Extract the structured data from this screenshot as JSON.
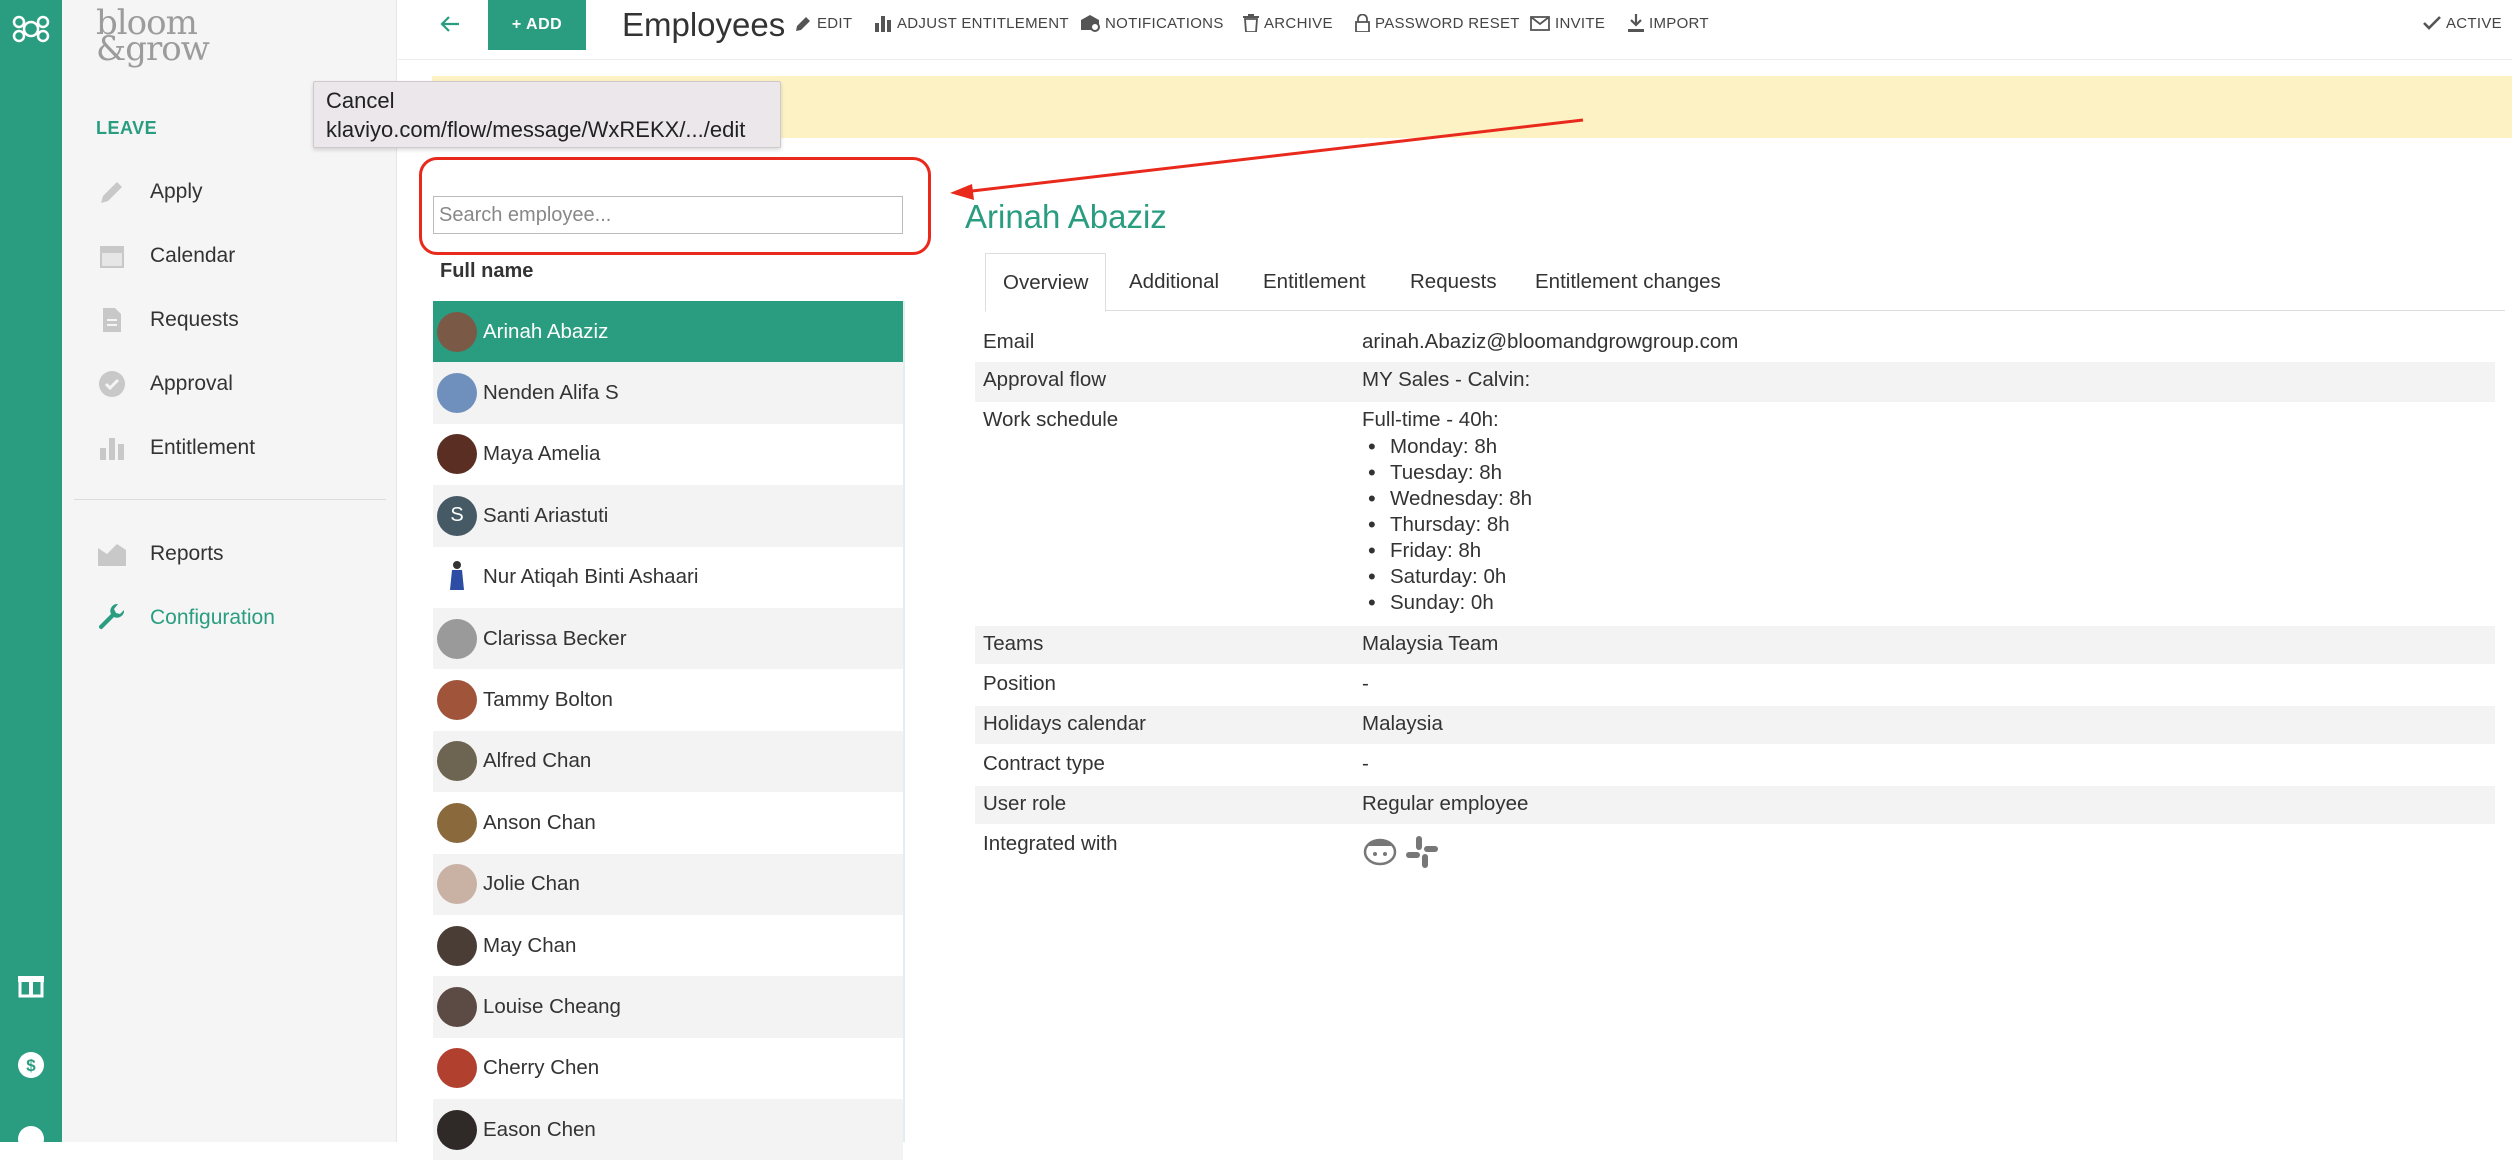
{
  "tooltip": {
    "line1": "Cancel",
    "line2": "klaviyo.com/flow/message/WxREKX/.../edit"
  },
  "sidebar": {
    "logo_line1": "bloom",
    "logo_line2": "&grow",
    "section_title": "LEAVE",
    "items": [
      {
        "label": "Apply",
        "icon": "pencil-icon"
      },
      {
        "label": "Calendar",
        "icon": "calendar-icon"
      },
      {
        "label": "Requests",
        "icon": "document-icon"
      },
      {
        "label": "Approval",
        "icon": "check-circle-icon"
      },
      {
        "label": "Entitlement",
        "icon": "bar-chart-icon"
      }
    ],
    "items2": [
      {
        "label": "Reports",
        "icon": "reports-icon"
      },
      {
        "label": "Configuration",
        "icon": "wrench-icon"
      }
    ]
  },
  "toolbar": {
    "add_label": "+ ADD",
    "title": "Employees",
    "edit": "EDIT",
    "adjust": "ADJUST ENTITLEMENT",
    "notifications": "NOTIFICATIONS",
    "archive": "ARCHIVE",
    "password_reset": "PASSWORD RESET",
    "invite": "INVITE",
    "import": "IMPORT",
    "active": "ACTIVE"
  },
  "search": {
    "placeholder": "Search employee..."
  },
  "list": {
    "header": "Full name",
    "employees": [
      "Arinah Abaziz",
      "Nenden Alifa S",
      "Maya Amelia",
      "Santi Ariastuti",
      "Nur Atiqah Binti Ashaari",
      "Clarissa Becker",
      "Tammy Bolton",
      "Alfred Chan",
      "Anson Chan",
      "Jolie Chan",
      "May Chan",
      "Louise Cheang",
      "Cherry Chen",
      "Eason Chen"
    ],
    "initial_avatar_letter": "S"
  },
  "detail": {
    "name": "Arinah Abaziz",
    "tabs": [
      "Overview",
      "Additional",
      "Entitlement",
      "Requests",
      "Entitlement changes"
    ],
    "email_label": "Email",
    "email_value": "arinah.Abaziz@bloomandgrowgroup.com",
    "approval_label": "Approval flow",
    "approval_value": "MY Sales - Calvin:",
    "schedule_label": "Work schedule",
    "schedule_value": "Full-time - 40h:",
    "schedule_days": [
      "Monday: 8h",
      "Tuesday: 8h",
      "Wednesday: 8h",
      "Thursday: 8h",
      "Friday: 8h",
      "Saturday: 0h",
      "Sunday: 0h"
    ],
    "teams_label": "Teams",
    "teams_value": "Malaysia Team",
    "position_label": "Position",
    "position_value": "-",
    "holidays_label": "Holidays calendar",
    "holidays_value": "Malaysia",
    "contract_label": "Contract type",
    "contract_value": "-",
    "role_label": "User role",
    "role_value": "Regular employee",
    "integrated_label": "Integrated with",
    "integrations": [
      "bamboo-face-icon",
      "slack-icon"
    ]
  },
  "colors": {
    "brand": "#2a9d81",
    "banner": "#fdf2c4",
    "annotation": "#e8291c"
  }
}
